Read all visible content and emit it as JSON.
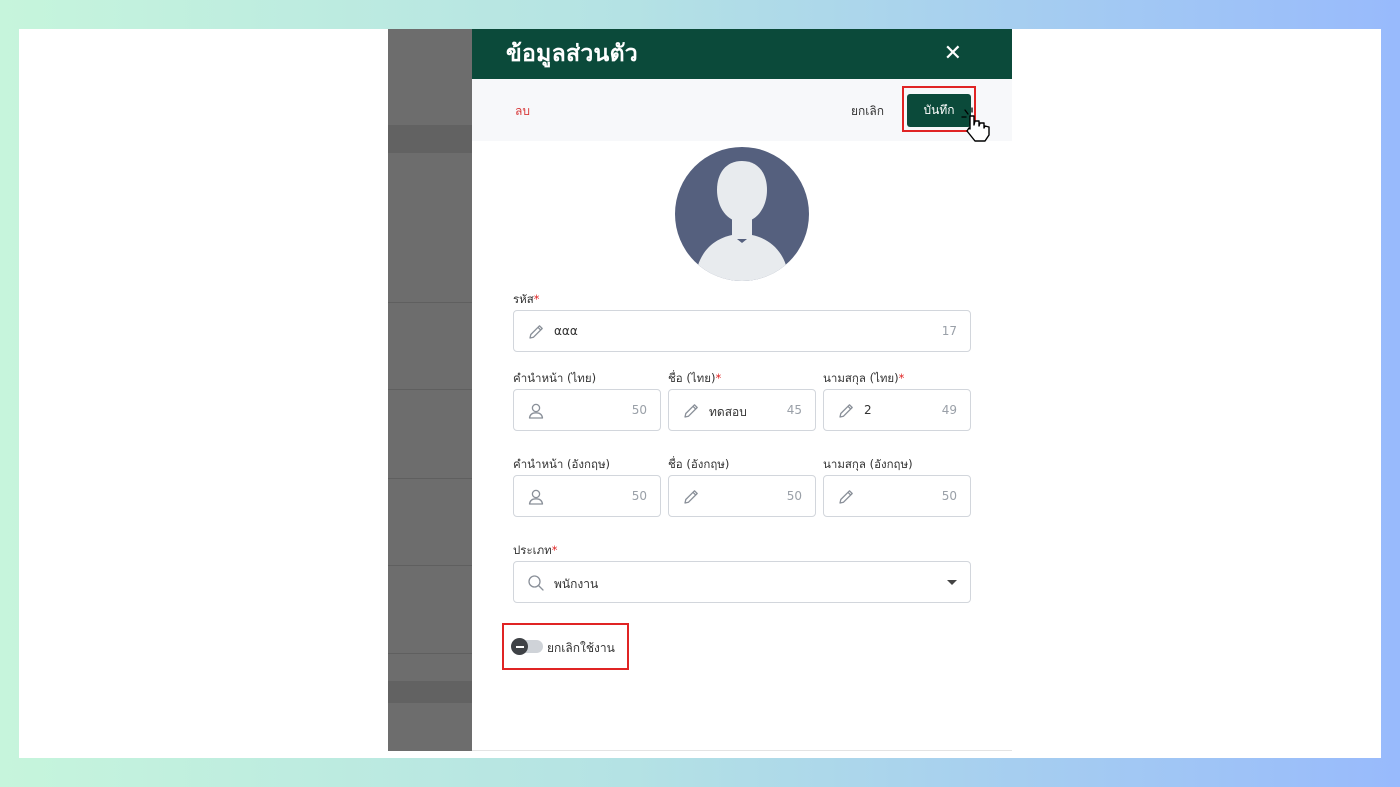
{
  "panel": {
    "title": "ข้อมูลส่วนตัว",
    "close_glyph": "✕"
  },
  "toolbar": {
    "delete_label": "ลบ",
    "cancel_label": "ยกเลิก",
    "save_label": "บันทึก"
  },
  "fields": {
    "code": {
      "label": "รหัส",
      "value": "ααα",
      "counter": "17"
    },
    "prefix_th": {
      "label": "คำนำหน้า (ไทย)",
      "value": "",
      "counter": "50"
    },
    "first_name_th": {
      "label": "ชื่อ (ไทย)",
      "value": "ทดสอบ",
      "counter": "45"
    },
    "last_name_th": {
      "label": "นามสกุล (ไทย)",
      "value": "2",
      "counter": "49"
    },
    "prefix_en": {
      "label": "คำนำหน้า (อังกฤษ)",
      "value": "",
      "counter": "50"
    },
    "first_name_en": {
      "label": "ชื่อ (อังกฤษ)",
      "value": "",
      "counter": "50"
    },
    "last_name_en": {
      "label": "นามสกุล (อังกฤษ)",
      "value": "",
      "counter": "50"
    },
    "type": {
      "label": "ประเภท",
      "value": "พนักงาน"
    }
  },
  "required_mark": "*",
  "toggle": {
    "label": "ยกเลิกใช้งาน",
    "state": "off"
  },
  "colors": {
    "header_bg": "#0b4a3a",
    "accent_red": "#e02424",
    "delete_red": "#d83a3a",
    "avatar_bg": "#55607e"
  },
  "icons": {
    "close": "close-icon",
    "pencil": "pencil-icon",
    "person": "person-icon",
    "search": "search-icon",
    "caret": "chevron-down-icon",
    "cursor": "hand-pointer-icon"
  }
}
